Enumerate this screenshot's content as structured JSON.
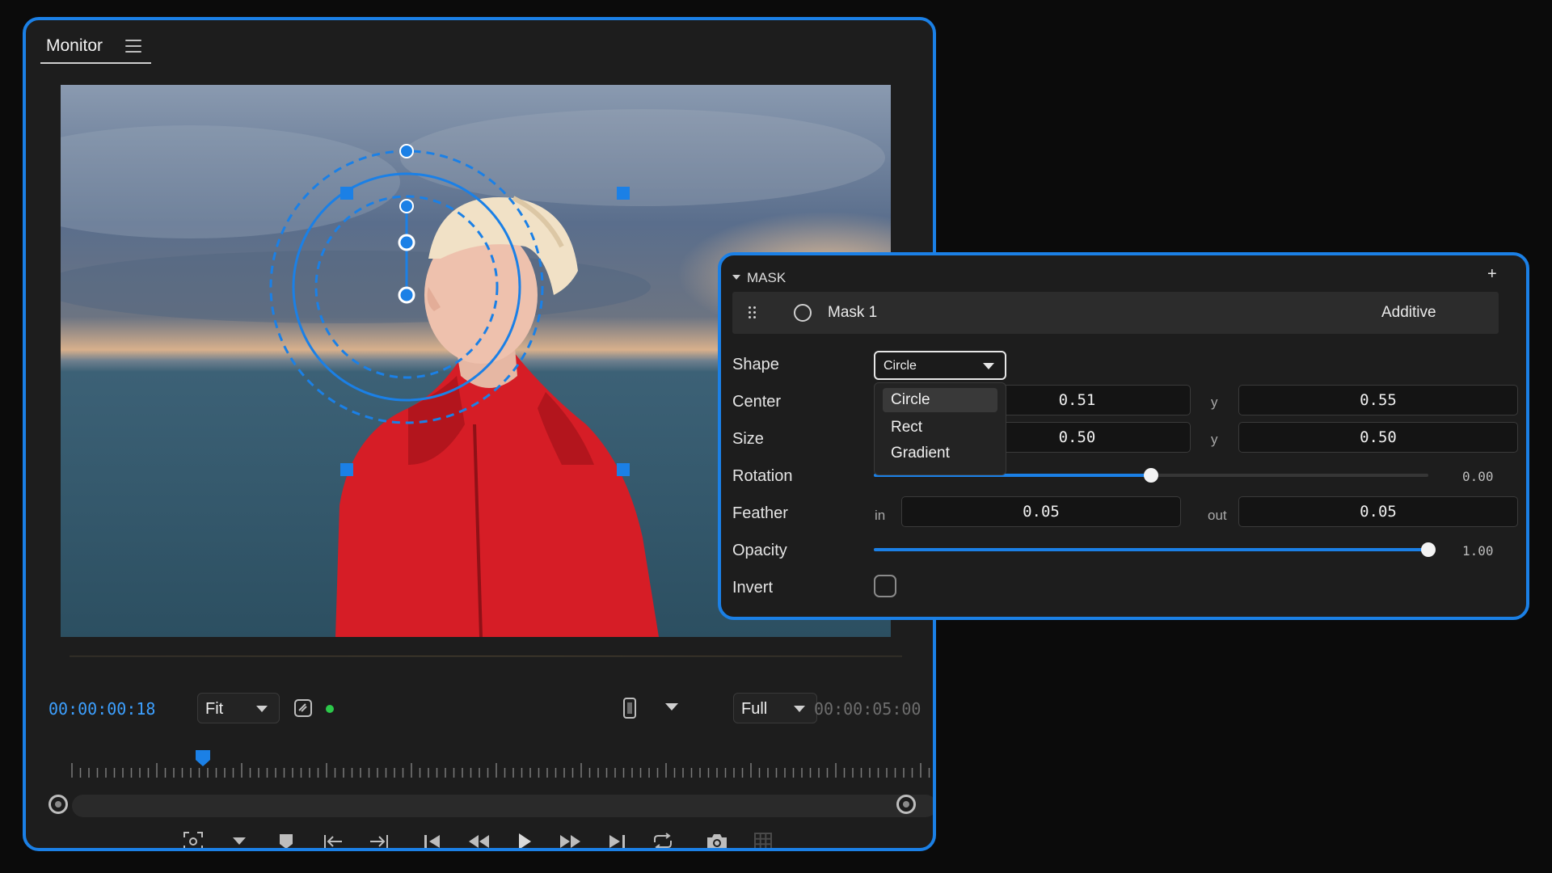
{
  "colors": {
    "accent": "#1b80e6",
    "timecode": "#3da0ff",
    "status_dot": "#2cc84a"
  },
  "monitor": {
    "title": "Monitor",
    "menu_icon": "hamburger-icon",
    "toolbar": {
      "current_timecode": "00:00:00:18",
      "zoom_value": "Fit",
      "quality_value": "Full",
      "total_timecode": "00:00:05:00"
    },
    "transport_icons": [
      "fullscreen-focus-icon",
      "chevron-down-icon",
      "marker-icon",
      "go-to-in-icon",
      "go-to-out-icon",
      "step-back-icon",
      "rewind-icon",
      "play-icon",
      "fast-forward-icon",
      "step-forward-icon",
      "loop-icon",
      "camera-icon",
      "grid-icon"
    ]
  },
  "mask_panel": {
    "header": "MASK",
    "add_label": "+",
    "mask_item": {
      "name": "Mask 1",
      "mode": "Additive"
    },
    "labels": {
      "shape": "Shape",
      "center": "Center",
      "size": "Size",
      "rotation": "Rotation",
      "feather": "Feather",
      "opacity": "Opacity",
      "invert": "Invert"
    },
    "shape": {
      "selected": "Circle",
      "options": [
        "Circle",
        "Rect",
        "Gradient"
      ]
    },
    "center": {
      "x": "0.51",
      "y_label": "y",
      "y": "0.55"
    },
    "size": {
      "x": "0.50",
      "y_label": "y",
      "y": "0.50"
    },
    "rotation": {
      "value": "0.00",
      "slider_fraction": 0.5
    },
    "feather": {
      "in_label": "in",
      "in": "0.05",
      "out_label": "out",
      "out": "0.05"
    },
    "opacity": {
      "value": "1.00",
      "slider_fraction": 1.0
    },
    "invert": {
      "checked": false
    }
  }
}
